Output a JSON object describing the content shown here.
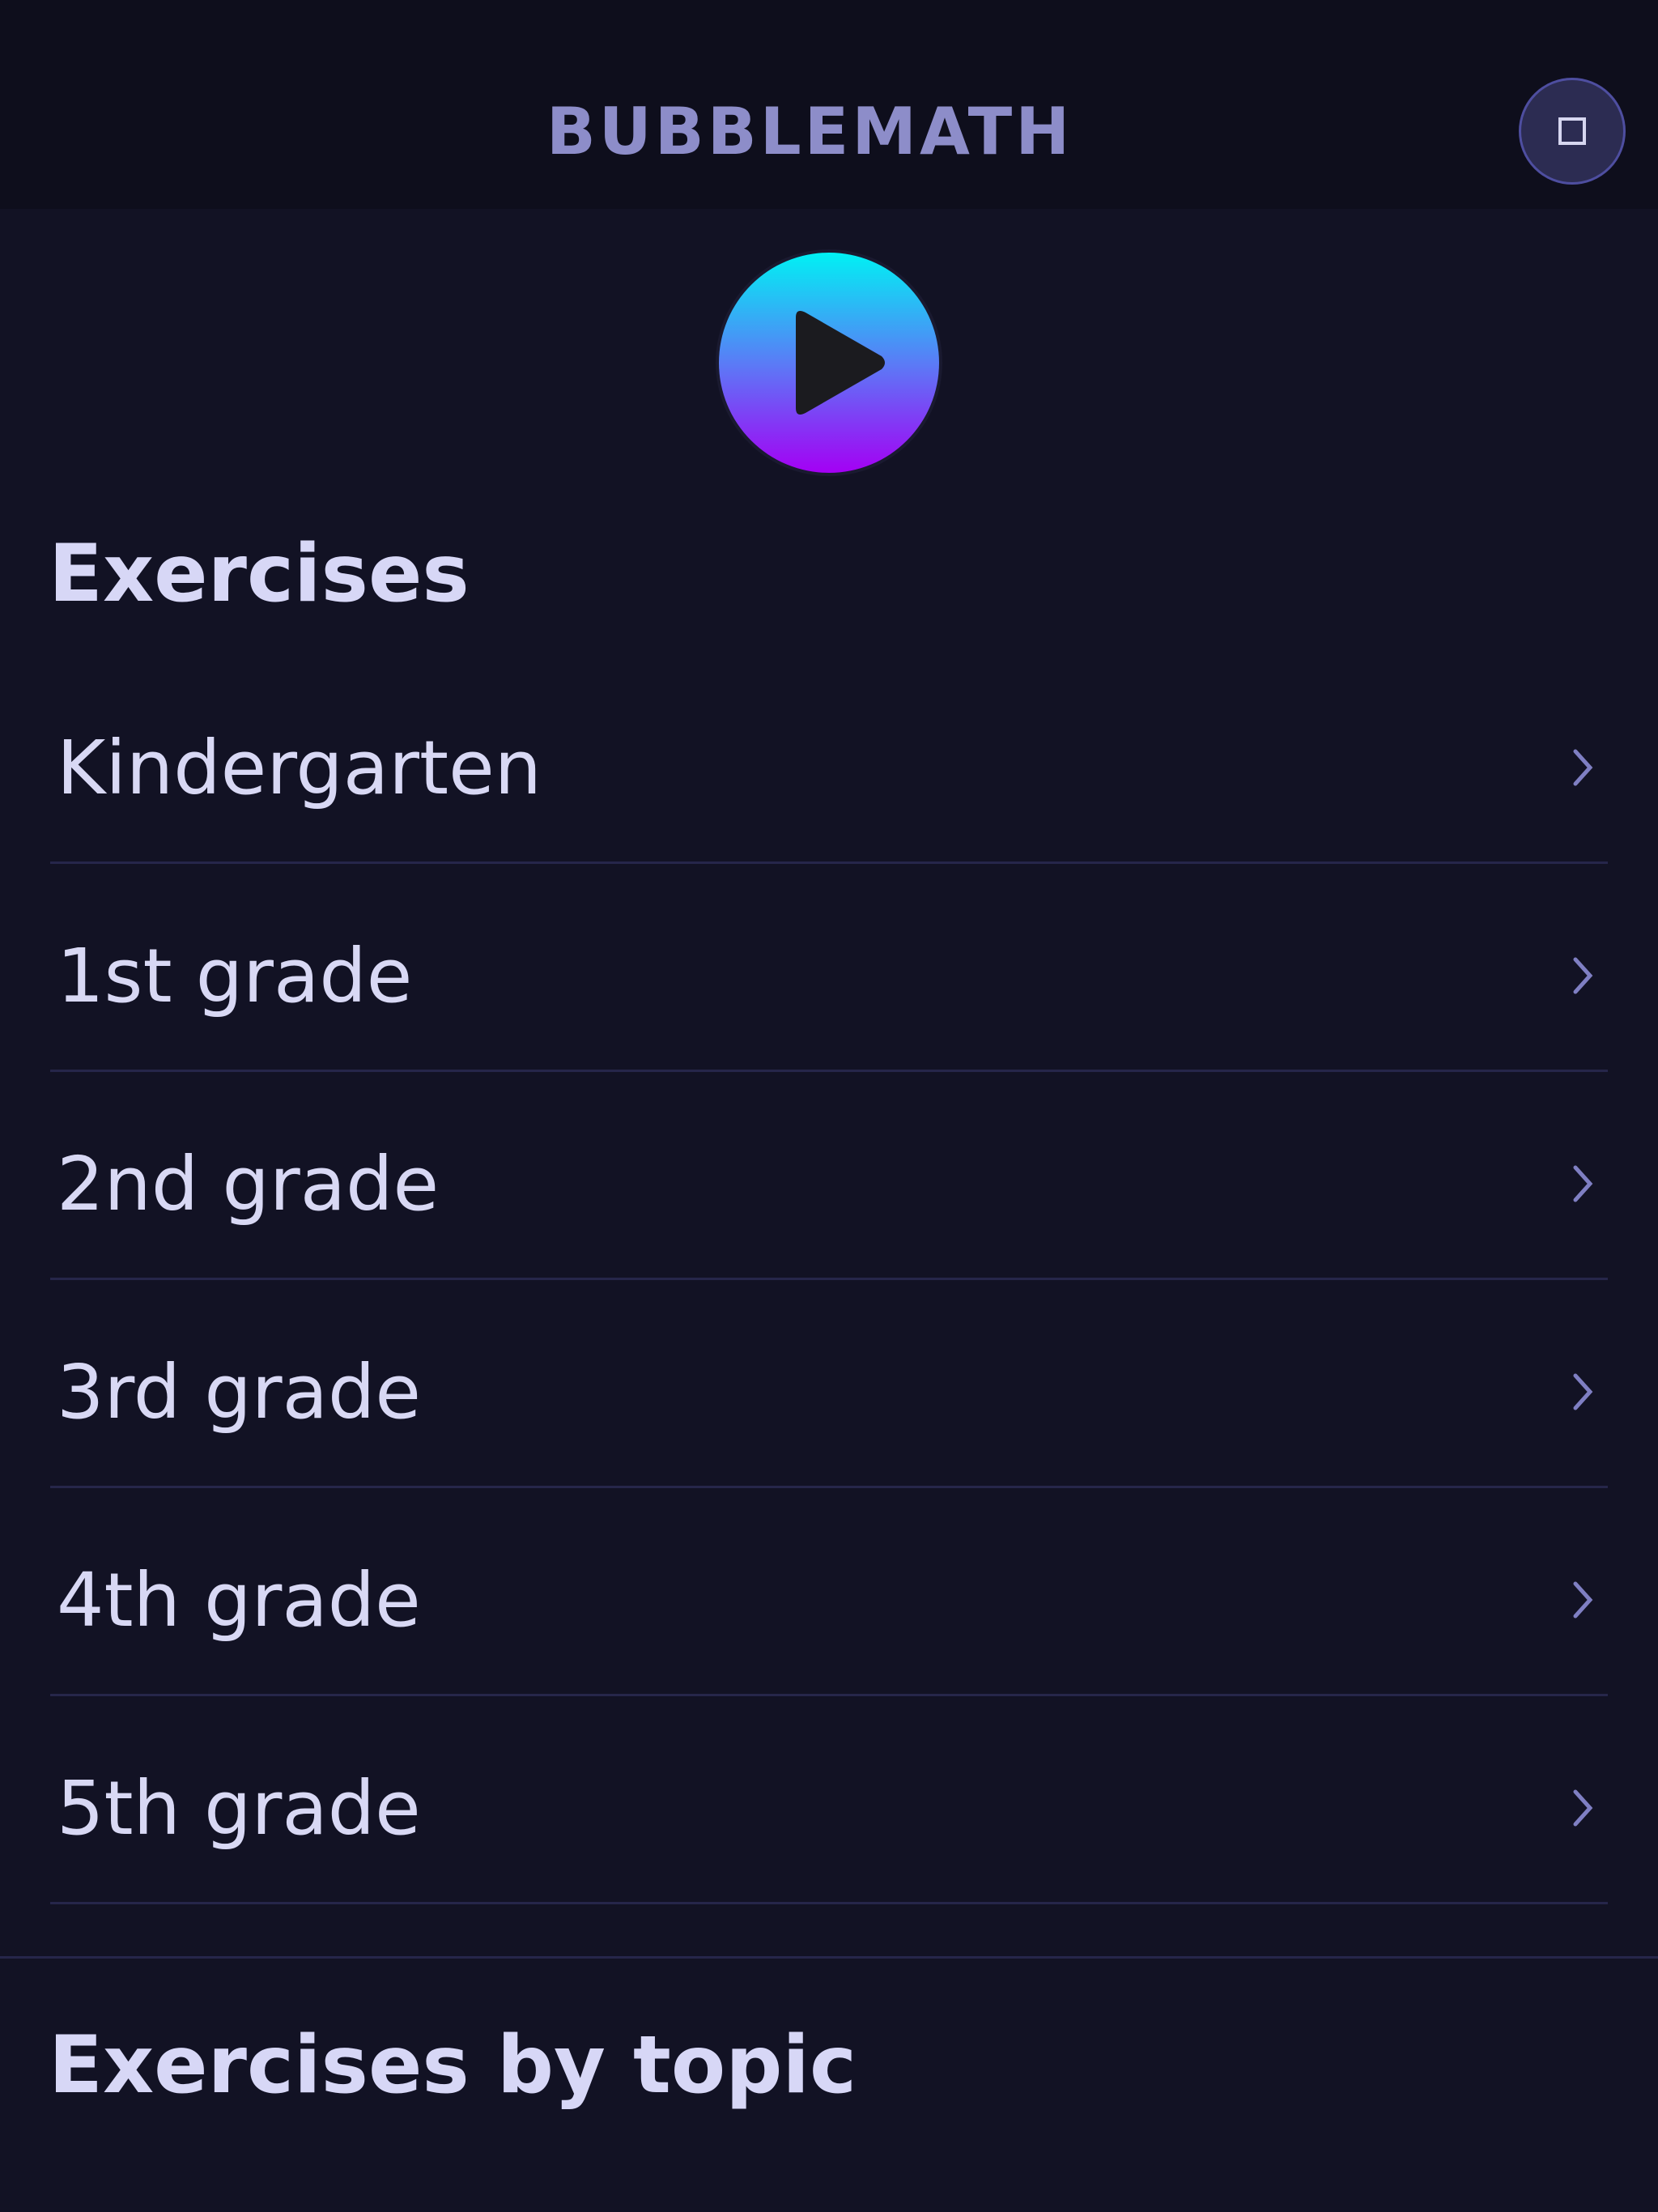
{
  "header": {
    "title": "BUBBLEMATH",
    "menu_icon": "square-icon"
  },
  "play": {
    "icon": "play-icon",
    "colors": [
      "#00f1f4",
      "#5a7cf6",
      "#a400f4"
    ]
  },
  "exercises": {
    "title": "Exercises",
    "items": [
      {
        "label": "Kindergarten"
      },
      {
        "label": "1st grade"
      },
      {
        "label": "2nd grade"
      },
      {
        "label": "3rd grade"
      },
      {
        "label": "4th grade"
      },
      {
        "label": "5th grade"
      }
    ]
  },
  "topics": {
    "title": "Exercises by topic"
  }
}
